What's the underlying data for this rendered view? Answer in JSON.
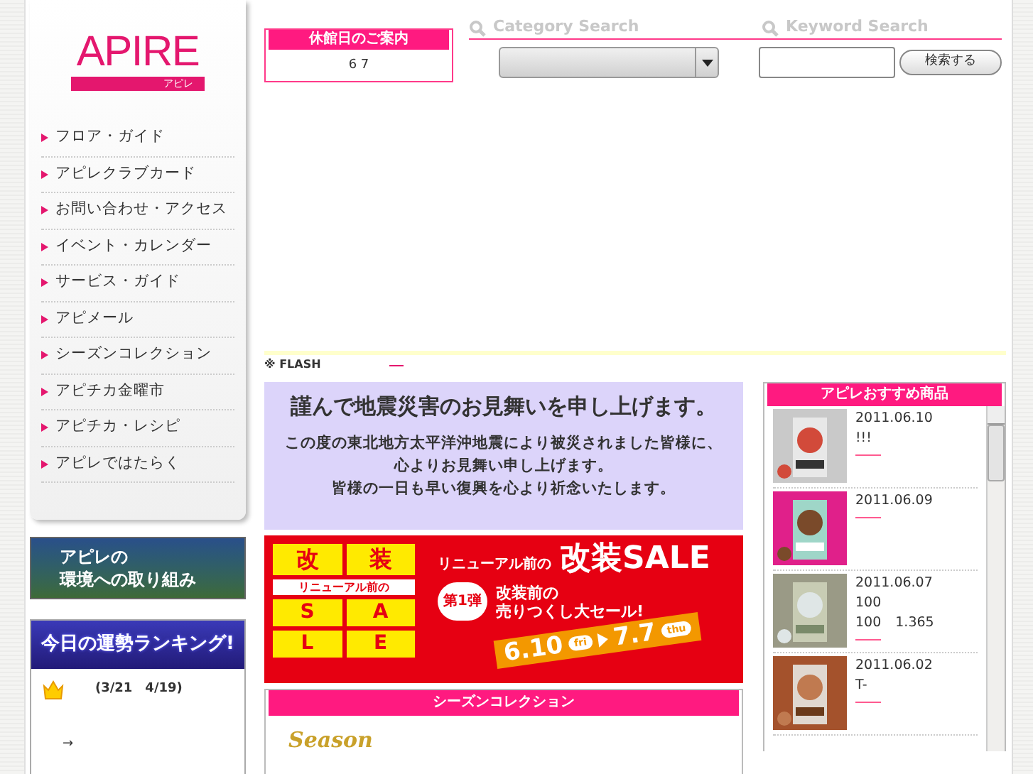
{
  "logo": {
    "text": "APIRE",
    "subtitle": "アピレ"
  },
  "nav": [
    {
      "label": "フロア・ガイド"
    },
    {
      "label": "アピレクラブカード"
    },
    {
      "label": "お問い合わせ・アクセス"
    },
    {
      "label": "イベント・カレンダー"
    },
    {
      "label": "サービス・ガイド"
    },
    {
      "label": "アピメール"
    },
    {
      "label": "シーズンコレクション"
    },
    {
      "label": "アピチカ金曜市"
    },
    {
      "label": "アピチカ・レシピ"
    },
    {
      "label": "アピレではたらく"
    }
  ],
  "environment_banner": {
    "lines": [
      "アピレの",
      "環境への取り組み"
    ]
  },
  "fortune": {
    "title": "今日の運勢ランキング!",
    "period": "(3/21　4/19)",
    "arrow": "→"
  },
  "holiday": {
    "title": "休館日のご案内",
    "value": "6 7"
  },
  "category_search": {
    "heading": "Category Search"
  },
  "keyword_search": {
    "heading": "Keyword Search",
    "button": "検索する"
  },
  "flash_note": "※ FLASH",
  "notice": {
    "title": "謹んで地震災害のお見舞いを申し上げます。",
    "lines": [
      "この度の東北地方太平洋沖地震により被災されました皆様に、",
      "心よりお見舞い申し上げます。",
      "皆様の一日も早い復興を心より祈念いたします。"
    ]
  },
  "sale_banner": {
    "badge_chars": [
      "改",
      "装",
      "S",
      "A",
      "L",
      "E"
    ],
    "ribbon": "リニューアル前の",
    "headline_prefix": "リニューアル前の",
    "headline": "改装SALE",
    "burst": "第1弾",
    "sub_lines": [
      "改装前の",
      "売りつくし大セール!"
    ],
    "start": "6.10",
    "start_day": "fri",
    "end": "7.7",
    "end_day": "thu"
  },
  "season": {
    "title": "シーズンコレクション",
    "logo": "Season"
  },
  "recommend": {
    "title": "アピレおすすめ商品",
    "items": [
      {
        "date": "2011.06.10",
        "lines": [
          "!!!"
        ]
      },
      {
        "date": "2011.06.09"
      },
      {
        "date": "2011.06.07",
        "lines": [
          "100",
          "100　1.365"
        ]
      },
      {
        "date": "2011.06.02",
        "lines": [
          "T-"
        ]
      }
    ]
  }
}
